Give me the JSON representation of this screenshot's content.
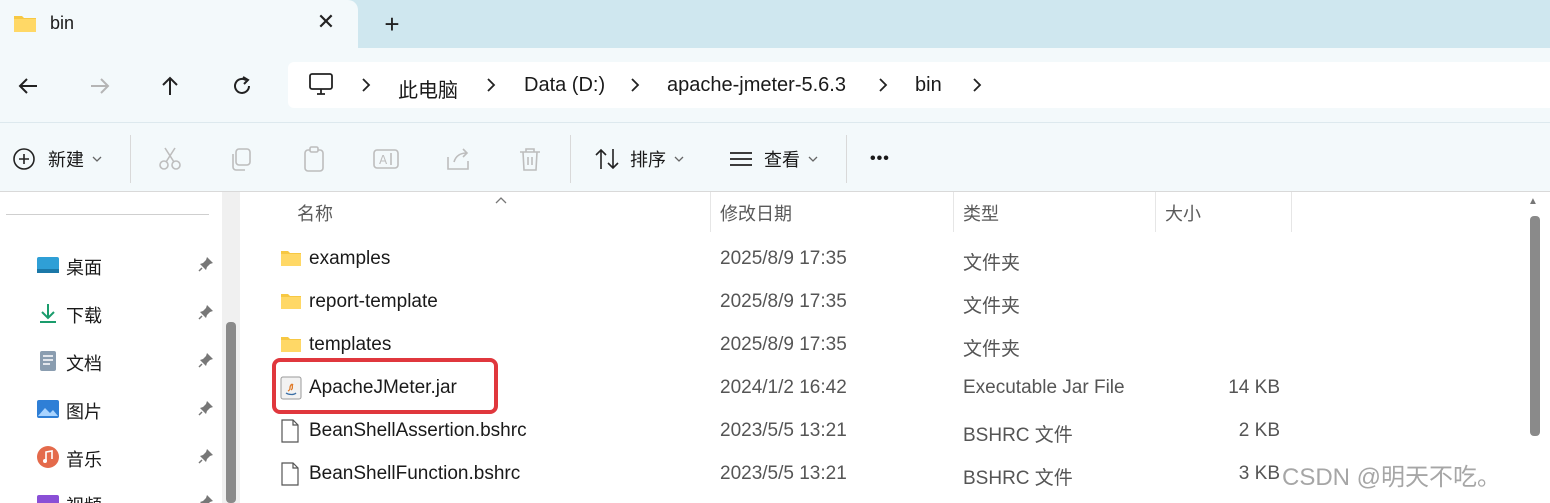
{
  "tab": {
    "title": "bin",
    "close": "✕",
    "new_tab": "+"
  },
  "breadcrumb": [
    {
      "label": "此电脑"
    },
    {
      "label": "Data (D:)"
    },
    {
      "label": "apache-jmeter-5.6.3"
    },
    {
      "label": "bin"
    }
  ],
  "commands": {
    "new_label": "新建",
    "sort_label": "排序",
    "view_label": "查看",
    "more_label": "•••"
  },
  "columns": {
    "name": "名称",
    "modified": "修改日期",
    "type": "类型",
    "size": "大小"
  },
  "sidebar": {
    "items": [
      {
        "label": "桌面",
        "icon": "desktop-icon"
      },
      {
        "label": "下载",
        "icon": "download-icon"
      },
      {
        "label": "文档",
        "icon": "document-icon"
      },
      {
        "label": "图片",
        "icon": "pictures-icon"
      },
      {
        "label": "音乐",
        "icon": "music-icon"
      },
      {
        "label": "视频",
        "icon": "video-icon"
      }
    ]
  },
  "files": [
    {
      "name": "examples",
      "modified": "2025/8/9 17:35",
      "type": "文件夹",
      "size": "",
      "icon": "folder-icon"
    },
    {
      "name": "report-template",
      "modified": "2025/8/9 17:35",
      "type": "文件夹",
      "size": "",
      "icon": "folder-icon"
    },
    {
      "name": "templates",
      "modified": "2025/8/9 17:35",
      "type": "文件夹",
      "size": "",
      "icon": "folder-icon"
    },
    {
      "name": "ApacheJMeter.jar",
      "modified": "2024/1/2 16:42",
      "type": "Executable Jar File",
      "size": "14 KB",
      "icon": "java-jar-icon"
    },
    {
      "name": "BeanShellAssertion.bshrc",
      "modified": "2023/5/5 13:21",
      "type": "BSHRC 文件",
      "size": "2 KB",
      "icon": "file-icon"
    },
    {
      "name": "BeanShellFunction.bshrc",
      "modified": "2023/5/5 13:21",
      "type": "BSHRC 文件",
      "size": "3 KB",
      "icon": "file-icon"
    }
  ],
  "watermark": "CSDN @明天不吃。",
  "colors": {
    "accent_highlight": "#e0373d",
    "folder": "#f7c843",
    "titlebar": "#cfe7ef"
  }
}
